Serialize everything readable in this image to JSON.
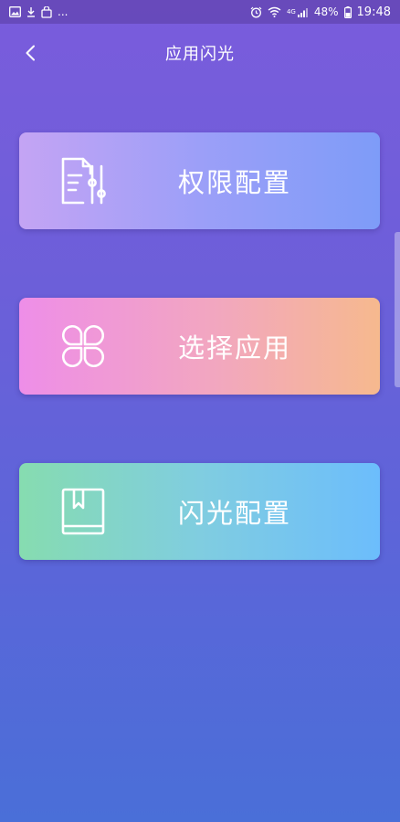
{
  "status_bar": {
    "left_icons": [
      "gallery-icon",
      "download-icon",
      "bag-icon"
    ],
    "more": "...",
    "network": "4G",
    "battery": "48%",
    "time": "19:48"
  },
  "header": {
    "title": "应用闪光"
  },
  "menu": {
    "items": [
      {
        "label": "权限配置",
        "icon": "permission-settings-icon"
      },
      {
        "label": "选择应用",
        "icon": "clover-apps-icon"
      },
      {
        "label": "闪光配置",
        "icon": "book-icon"
      }
    ]
  }
}
